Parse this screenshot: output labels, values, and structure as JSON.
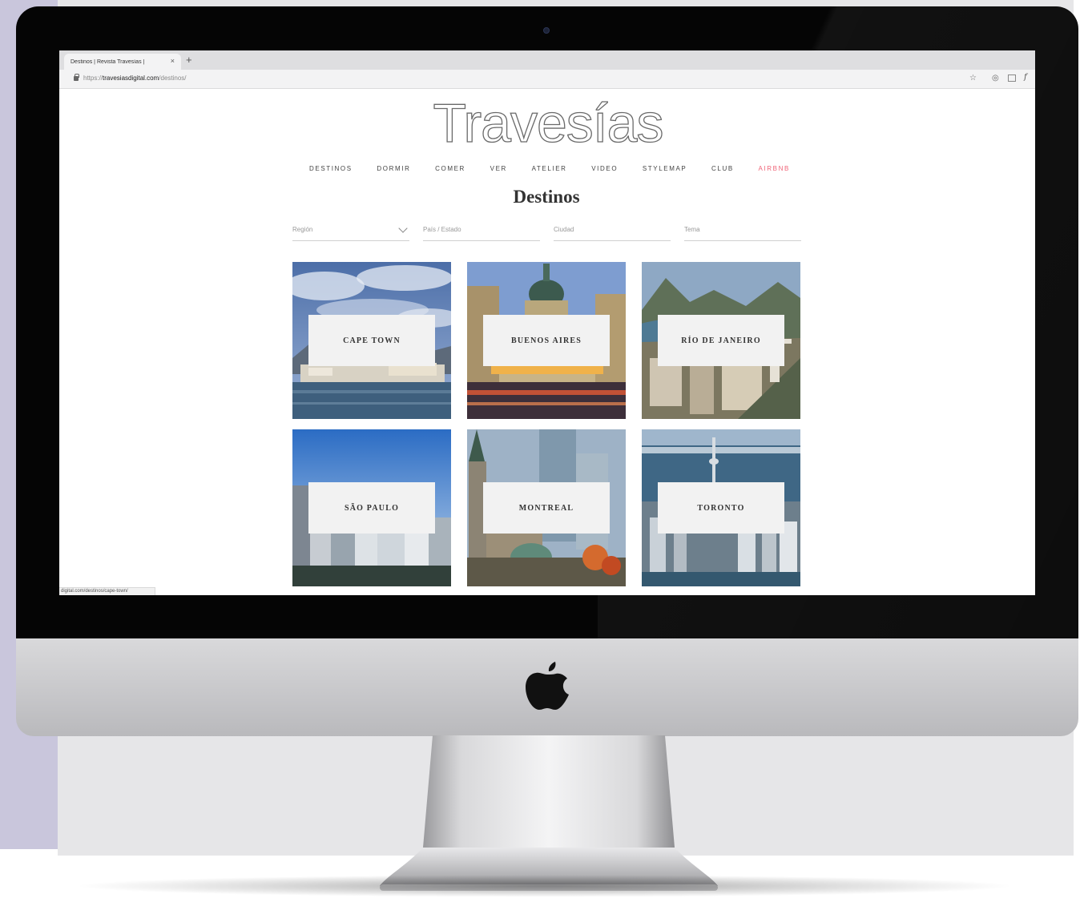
{
  "browser": {
    "tab_title": "Destinos | Revista Travesías |",
    "tab_close": "×",
    "new_tab": "+",
    "url_prefix": "https://",
    "url_host": "travesiasdigital.com",
    "url_path": "/destinos/",
    "status_url": "digital.com/destinos/cape-town/"
  },
  "site": {
    "logo": "Travesías",
    "nav": [
      "DESTINOS",
      "DORMIR",
      "COMER",
      "VER",
      "ATELIER",
      "VIDEO",
      "STYLEMAP",
      "CLUB",
      "AIRBNB"
    ],
    "page_title": "Destinos",
    "filters": {
      "region": "Región",
      "country": "País / Estado",
      "city": "Ciudad",
      "topic": "Tema"
    },
    "destinations": [
      {
        "name": "CAPE TOWN"
      },
      {
        "name": "BUENOS AIRES"
      },
      {
        "name": "RÍO DE JANEIRO"
      },
      {
        "name": "SÃO PAULO"
      },
      {
        "name": "MONTREAL"
      },
      {
        "name": "TORONTO"
      }
    ]
  },
  "colors": {
    "accent_nav": "#f06478",
    "background_lavender": "#c9c6dc",
    "bezel": "#050505"
  },
  "icons": {
    "lock": "lock-icon",
    "star": "star-icon",
    "apple": "apple-logo-icon",
    "chevron": "chevron-down-icon"
  }
}
